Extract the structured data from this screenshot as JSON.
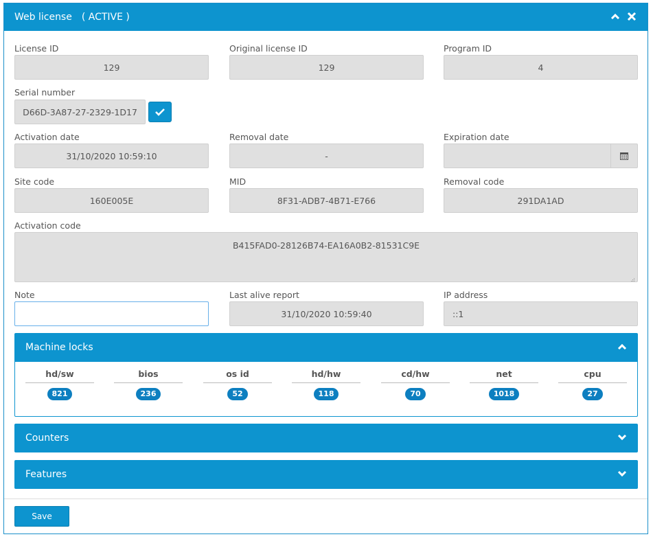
{
  "header": {
    "title": "Web license",
    "status": "( ACTIVE )",
    "collapse_icon": "chevron-up-icon",
    "close_icon": "close-icon"
  },
  "fields": {
    "license_id": {
      "label": "License ID",
      "value": "129"
    },
    "original_license_id": {
      "label": "Original license ID",
      "value": "129"
    },
    "program_id": {
      "label": "Program ID",
      "value": "4"
    },
    "serial_number": {
      "label": "Serial number",
      "value": "D66D-3A87-27-2329-1D17"
    },
    "activation_date": {
      "label": "Activation date",
      "value": "31/10/2020 10:59:10"
    },
    "removal_date": {
      "label": "Removal date",
      "value": "-"
    },
    "expiration_date": {
      "label": "Expiration date",
      "value": ""
    },
    "site_code": {
      "label": "Site code",
      "value": "160E005E"
    },
    "mid": {
      "label": "MID",
      "value": "8F31-ADB7-4B71-E766"
    },
    "removal_code": {
      "label": "Removal code",
      "value": "291DA1AD"
    },
    "activation_code": {
      "label": "Activation code",
      "value": "B415FAD0-28126B74-EA16A0B2-81531C9E"
    },
    "note": {
      "label": "Note",
      "value": ""
    },
    "last_alive_report": {
      "label": "Last alive report",
      "value": "31/10/2020 10:59:40"
    },
    "ip_address": {
      "label": "IP address",
      "value": "::1"
    }
  },
  "machine_locks": {
    "title": "Machine locks",
    "items": [
      {
        "name": "hd/sw",
        "count": "821"
      },
      {
        "name": "bios",
        "count": "236"
      },
      {
        "name": "os id",
        "count": "52"
      },
      {
        "name": "hd/hw",
        "count": "118"
      },
      {
        "name": "cd/hw",
        "count": "70"
      },
      {
        "name": "net",
        "count": "1018"
      },
      {
        "name": "cpu",
        "count": "27"
      }
    ]
  },
  "counters": {
    "title": "Counters"
  },
  "features": {
    "title": "Features"
  },
  "footer": {
    "save_label": "Save"
  },
  "colors": {
    "accent": "#0d94cf",
    "field_bg": "#e0e0e0",
    "badge": "#0d7fc0"
  }
}
